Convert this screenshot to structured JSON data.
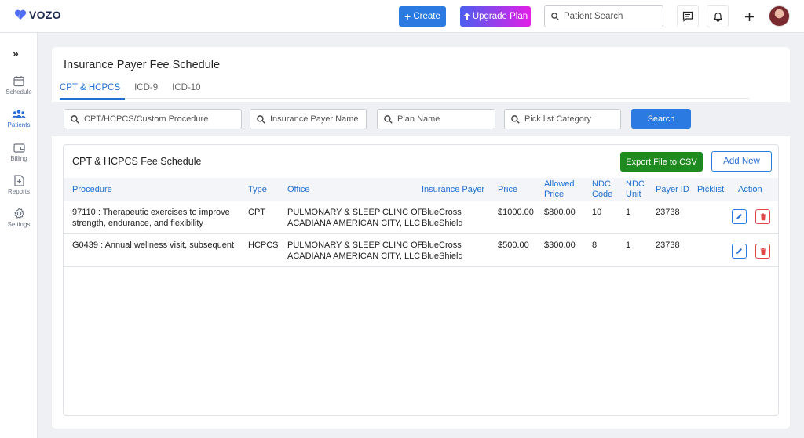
{
  "app": {
    "brand": "VOZO"
  },
  "header": {
    "create_label": "Create",
    "upgrade_label": "Upgrade Plan",
    "patient_search_placeholder": "Patient Search"
  },
  "sidebar": {
    "items": [
      {
        "label": "Schedule",
        "icon": "calendar-icon"
      },
      {
        "label": "Patients",
        "icon": "patients-icon",
        "active": true
      },
      {
        "label": "Billing",
        "icon": "wallet-icon"
      },
      {
        "label": "Reports",
        "icon": "report-icon"
      },
      {
        "label": "Settings",
        "icon": "gear-icon"
      }
    ]
  },
  "page": {
    "title": "Insurance Payer Fee Schedule",
    "tabs": [
      {
        "label": "CPT & HCPCS",
        "active": true
      },
      {
        "label": "ICD-9"
      },
      {
        "label": "ICD-10"
      }
    ]
  },
  "filters": {
    "procedure_placeholder": "CPT/HCPCS/Custom Procedure",
    "payer_placeholder": "Insurance Payer Name",
    "plan_placeholder": "Plan Name",
    "picklist_placeholder": "Pick list Category",
    "search_label": "Search"
  },
  "table": {
    "title": "CPT & HCPCS Fee Schedule",
    "export_label": "Export File to CSV",
    "add_label": "Add New",
    "columns": {
      "procedure": "Procedure",
      "type": "Type",
      "office": "Office",
      "payer": "Insurance Payer",
      "price": "Price",
      "allowed_1": "Allowed",
      "allowed_2": "Price",
      "ndc_code_1": "NDC",
      "ndc_code_2": "Code",
      "ndc_unit_1": "NDC",
      "ndc_unit_2": "Unit",
      "payer_id": "Payer ID",
      "picklist": "Picklist",
      "action": "Action"
    },
    "rows": [
      {
        "procedure_1": "97110 : Therapeutic exercises to improve",
        "procedure_2": "strength, endurance, and flexibility",
        "type": "CPT",
        "office_1": "PULMONARY & SLEEP CLINC OF",
        "office_2": "ACADIANA AMERICAN CITY, LLC",
        "payer_1": "BlueCross",
        "payer_2": "BlueShield",
        "price": "$1000.00",
        "allowed": "$800.00",
        "ndc_code": "10",
        "ndc_unit": "1",
        "payer_id": "23738",
        "picklist": ""
      },
      {
        "procedure_1": "G0439 : Annual wellness visit, subsequent",
        "procedure_2": "",
        "type": "HCPCS",
        "office_1": "PULMONARY & SLEEP CLINC OF",
        "office_2": "ACADIANA AMERICAN CITY, LLC",
        "payer_1": "BlueCross",
        "payer_2": "BlueShield",
        "price": "$500.00",
        "allowed": "$300.00",
        "ndc_code": "8",
        "ndc_unit": "1",
        "payer_id": "23738",
        "picklist": ""
      }
    ]
  },
  "colors": {
    "primary": "#2a7ae2",
    "export": "#1f8a1f",
    "delete": "#e04848"
  }
}
